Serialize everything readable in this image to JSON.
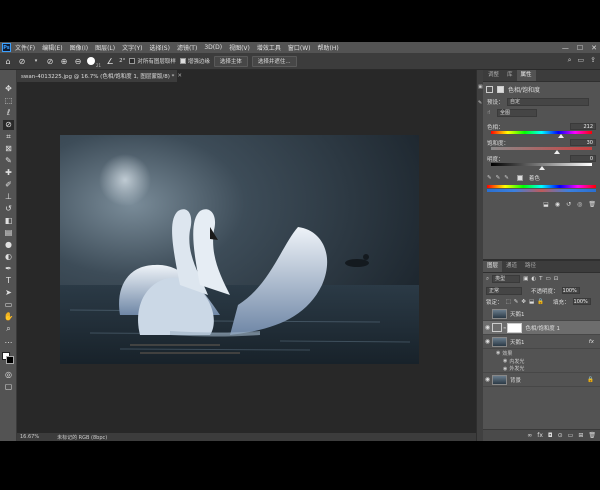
{
  "app": {
    "logo_text": "Ps",
    "menu": [
      "文件(F)",
      "编辑(E)",
      "图像(I)",
      "图层(L)",
      "文字(Y)",
      "选择(S)",
      "滤镜(T)",
      "3D(D)",
      "视图(V)",
      "增效工具",
      "窗口(W)",
      "帮助(H)"
    ],
    "window_controls": [
      "—",
      "☐",
      "✕"
    ]
  },
  "options": {
    "brush_size": "21",
    "angle_value": "2°",
    "sample_all_layers": "对所有图层取样",
    "enhance_edge": "增强边缘",
    "select_subject": "选择主体",
    "select_and_mask": "选择并遮住..."
  },
  "document": {
    "tab_title": "swan-4013225.jpg @ 16.7% (色相/饱和度 1, 图层蒙版/8) *",
    "zoom": "16.67%",
    "status": "未标记的 RGB (8bpc)"
  },
  "properties": {
    "tabs": [
      "调整",
      "库",
      "属性"
    ],
    "active_tab": "属性",
    "title": "色相/饱和度",
    "preset_label": "预设：",
    "preset_value": "自定",
    "channel_value": "全图",
    "hue_label": "色相：",
    "hue_value": "212",
    "sat_label": "饱和度：",
    "sat_value": "30",
    "light_label": "明度：",
    "light_value": "0",
    "hue_level": 0.69,
    "sat_level": 0.65,
    "light_level": 0.5,
    "colorize_label": "着色",
    "colorize_checked": true
  },
  "layers": {
    "tabs": [
      "图层",
      "通道",
      "路径"
    ],
    "filter_label": "类型",
    "blend_mode": "正常",
    "opacity_label": "不透明度：",
    "opacity_value": "100%",
    "lock_label": "锁定：",
    "fill_label": "填充：",
    "fill_value": "100%",
    "items": [
      {
        "name": "天鹅1",
        "visible": false,
        "selected": false,
        "fx": false
      },
      {
        "name": "色相/饱和度 1",
        "visible": true,
        "selected": true,
        "fx": false
      },
      {
        "name": "天鹅1",
        "visible": true,
        "selected": false,
        "fx": true
      },
      {
        "name": "背景",
        "visible": true,
        "selected": false,
        "fx": false
      }
    ],
    "effects_label": "效果",
    "effect_inner_glow": "内发光",
    "effect_outer_glow": "外发光",
    "bottom_buttons": [
      "fx",
      "⊙"
    ]
  },
  "colors": {
    "accent": "#3aa0ff",
    "panel_bg": "#535353",
    "canvas_bg": "#282828"
  }
}
